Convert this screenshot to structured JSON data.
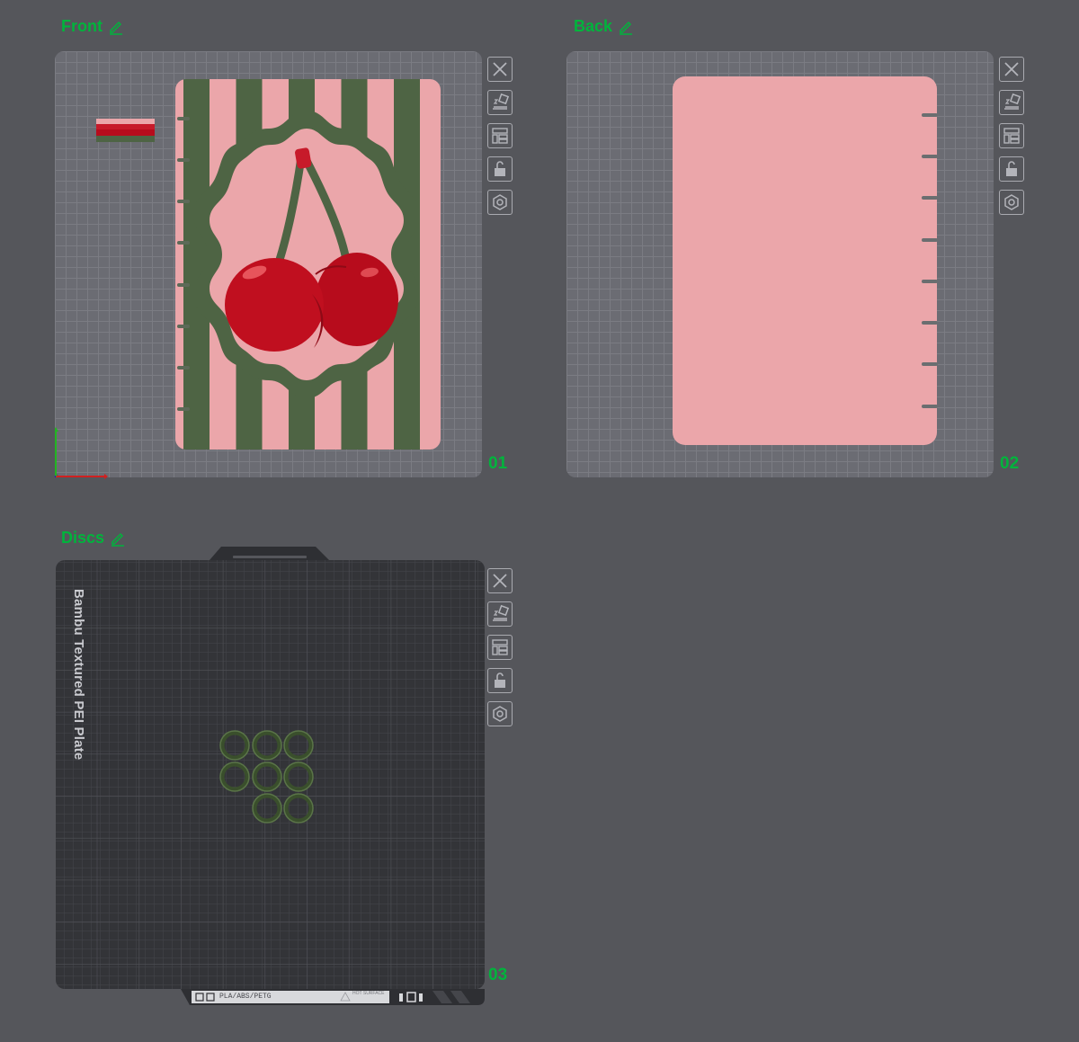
{
  "plates": [
    {
      "title": "Front",
      "number": "01"
    },
    {
      "title": "Back",
      "number": "02"
    },
    {
      "title": "Discs",
      "number": "03"
    }
  ],
  "plate3": {
    "bed_label": "Bambu Textured PEI Plate",
    "sticker_text": "PLA/ABS/PETG",
    "hot_surface_text": "HOT SURFACE"
  },
  "colors": {
    "accent": "#00b43c",
    "background": "#55565b",
    "pink": "#eba6aa",
    "green": "#4e6444",
    "cherry": "#c00f1f"
  },
  "toolbar_icons": [
    "close-icon",
    "auto-orient-icon",
    "arrange-icon",
    "lock-icon",
    "settings-icon"
  ]
}
